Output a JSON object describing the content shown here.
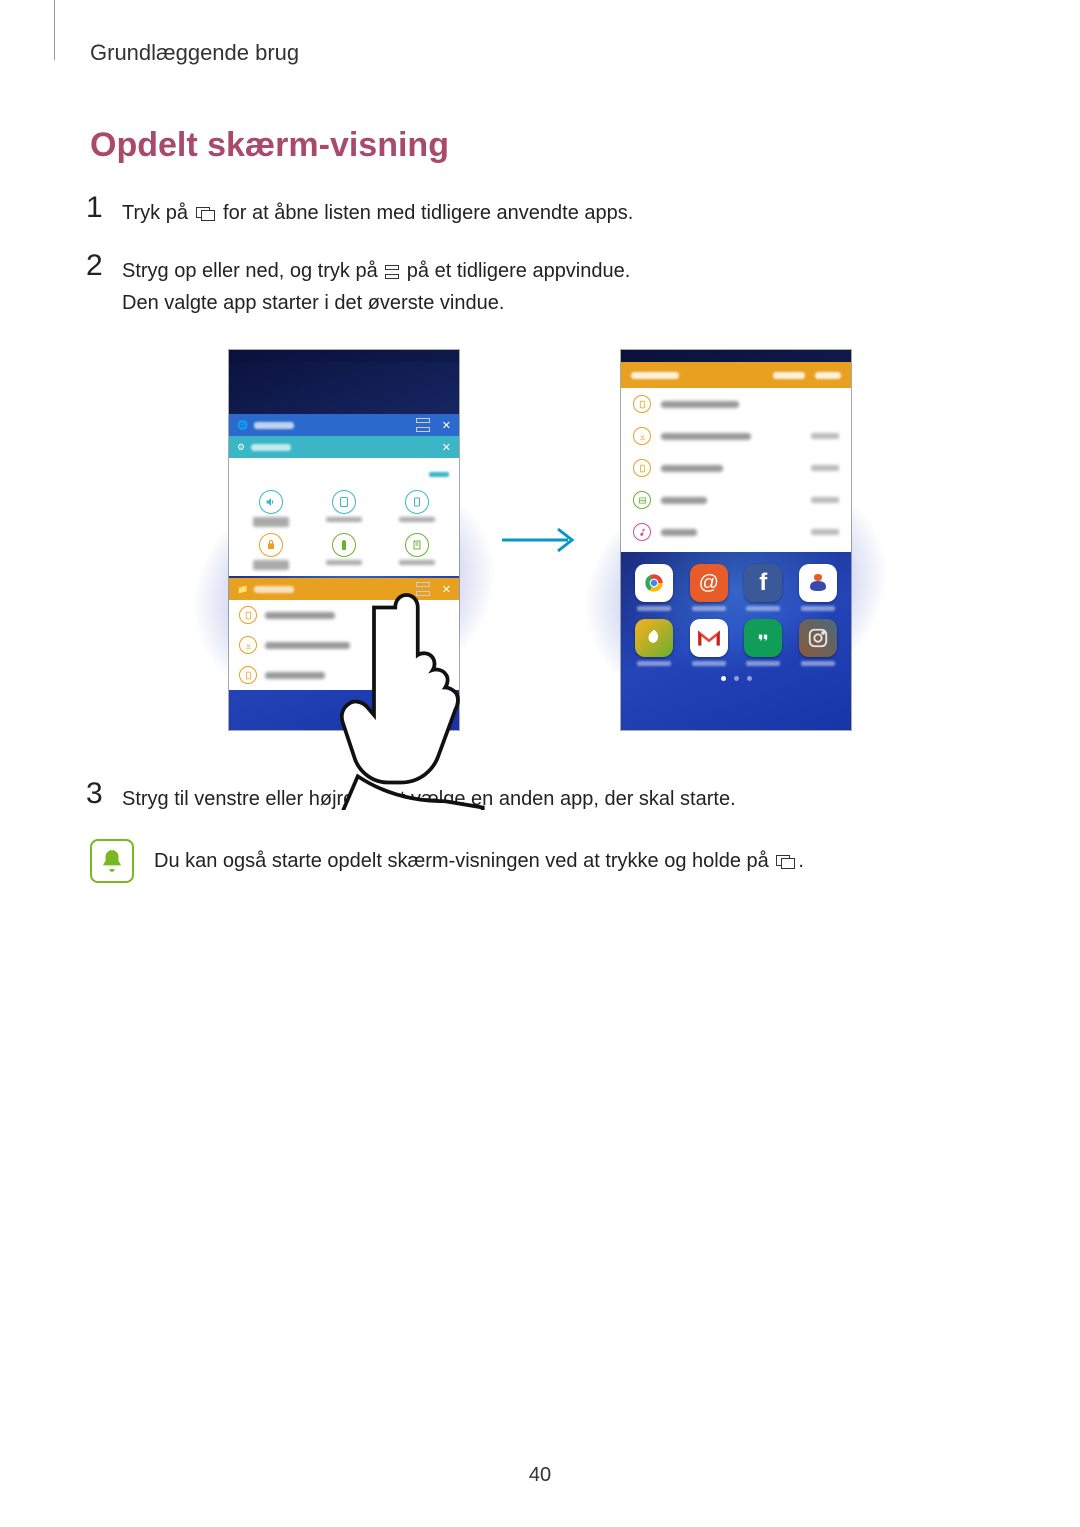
{
  "header": {
    "section": "Grundlæggende brug"
  },
  "title": "Opdelt skærm-visning",
  "steps": {
    "s1": {
      "num": "1",
      "pre": "Tryk på ",
      "post": " for at åbne listen med tidligere anvendte apps."
    },
    "s2": {
      "num": "2",
      "pre": "Stryg op eller ned, og tryk på ",
      "mid": " på et tidligere appvindue.",
      "line2": "Den valgte app starter i det øverste vindue."
    },
    "s3": {
      "num": "3",
      "text": "Stryg til venstre eller højre for at vælge en anden app, der skal starte."
    }
  },
  "note": {
    "pre": "Du kan også starte opdelt skærm-visningen ved at trykke og holde på ",
    "post": "."
  },
  "page_number": "40",
  "icons": {
    "recent_apps": "recent-apps-icon",
    "split": "split-view-icon",
    "note_bell": "note-bell-icon"
  },
  "illustration": {
    "phone1": {
      "cards": [
        "Internet",
        "Settings",
        "My Files"
      ],
      "settings_items": [
        "Sounds and vibration",
        "Display",
        "Edge screen",
        "Lock screen and security",
        "Battery",
        "User manual"
      ],
      "files_items": [
        "Device storage",
        "Download history",
        "Documents"
      ]
    },
    "phone2": {
      "files_header": "My Files",
      "files_items": [
        "Device storage",
        "Download history",
        "Documents",
        "Images",
        "Audio"
      ],
      "apps": [
        "Chrome",
        "Email",
        "Facebook",
        "Samsung",
        "Gallery",
        "Gmail",
        "Hangouts",
        "Instagram"
      ]
    }
  }
}
